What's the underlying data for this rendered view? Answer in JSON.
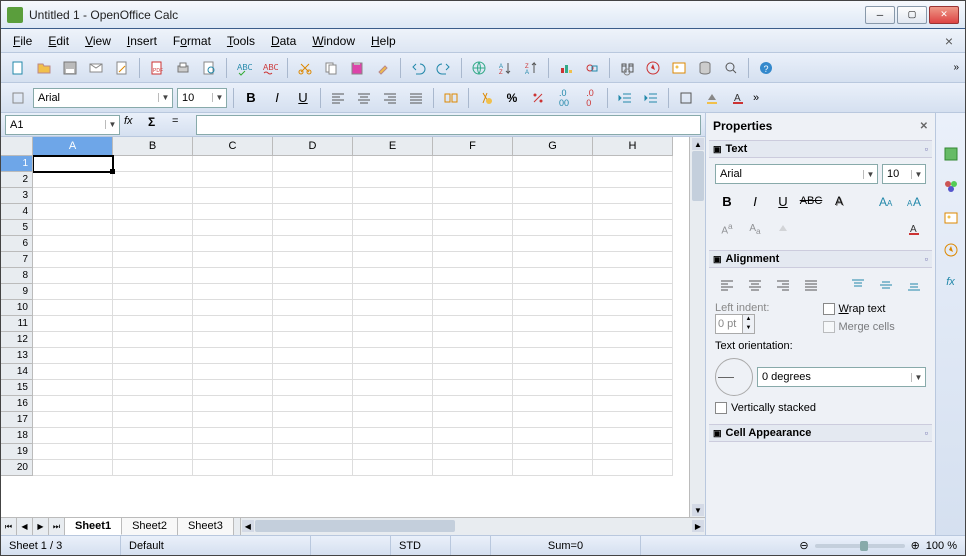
{
  "window": {
    "title": "Untitled 1 - OpenOffice Calc"
  },
  "menu": {
    "file": "File",
    "edit": "Edit",
    "view": "View",
    "insert": "Insert",
    "format": "Format",
    "tools": "Tools",
    "data": "Data",
    "window": "Window",
    "help": "Help"
  },
  "font": {
    "name": "Arial",
    "size": "10"
  },
  "namebox": {
    "value": "A1"
  },
  "formula": {
    "eq": "="
  },
  "columns": [
    "A",
    "B",
    "C",
    "D",
    "E",
    "F",
    "G",
    "H"
  ],
  "rows": [
    "1",
    "2",
    "3",
    "4",
    "5",
    "6",
    "7",
    "8",
    "9",
    "10",
    "11",
    "12",
    "13",
    "14",
    "15",
    "16",
    "17",
    "18",
    "19",
    "20"
  ],
  "active_cell": {
    "row": 0,
    "col": 0
  },
  "tabs": [
    "Sheet1",
    "Sheet2",
    "Sheet3"
  ],
  "properties": {
    "title": "Properties",
    "text_section": "Text",
    "font": "Arial",
    "size": "10",
    "align_section": "Alignment",
    "left_indent_label": "Left indent:",
    "left_indent_value": "0 pt",
    "wrap_label": "Wrap text",
    "merge_label": "Merge cells",
    "orient_label": "Text orientation:",
    "orient_value": "0 degrees",
    "vertstack_label": "Vertically stacked",
    "cellapp_section": "Cell Appearance"
  },
  "status": {
    "sheet": "Sheet 1 / 3",
    "style": "Default",
    "mode": "STD",
    "sum": "Sum=0",
    "zoom": "100 %"
  }
}
